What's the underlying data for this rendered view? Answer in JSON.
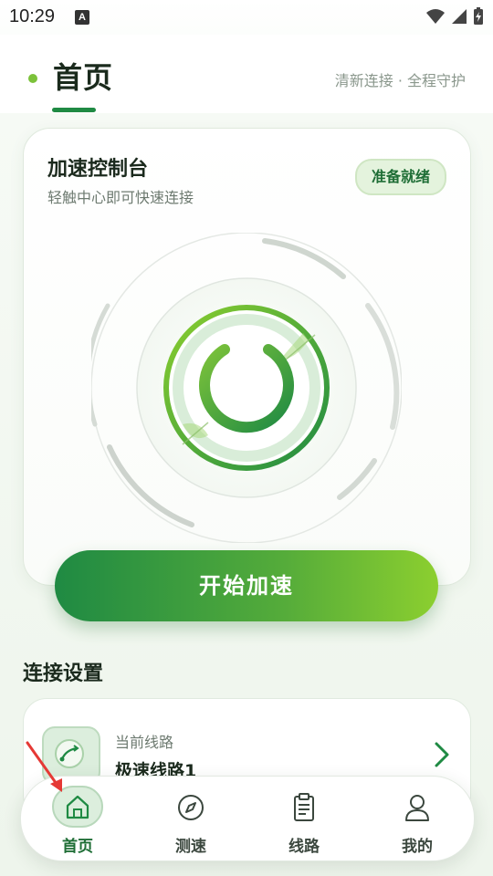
{
  "status_bar": {
    "time": "10:29",
    "notification_icon_letter": "A"
  },
  "header": {
    "title": "首页",
    "subtitle": "清新连接 · 全程守护"
  },
  "console": {
    "title": "加速控制台",
    "subtitle": "轻触中心即可快速连接",
    "status": "准备就绪",
    "power_icon": "power-icon"
  },
  "start_button": {
    "label": "开始加速"
  },
  "connection_settings": {
    "title": "连接设置",
    "route": {
      "label": "当前线路",
      "name": "极速线路1",
      "icon": "route-icon"
    }
  },
  "tabs": [
    {
      "label": "首页",
      "icon": "home-icon",
      "active": true
    },
    {
      "label": "测速",
      "icon": "compass-icon",
      "active": false
    },
    {
      "label": "线路",
      "icon": "clipboard-icon",
      "active": false
    },
    {
      "label": "我的",
      "icon": "user-icon",
      "active": false
    }
  ],
  "colors": {
    "primary": "#1f8a43",
    "accent": "#8ccf2f",
    "status_pill_bg": "#e4f3dd",
    "annotation_arrow": "#e53935"
  }
}
